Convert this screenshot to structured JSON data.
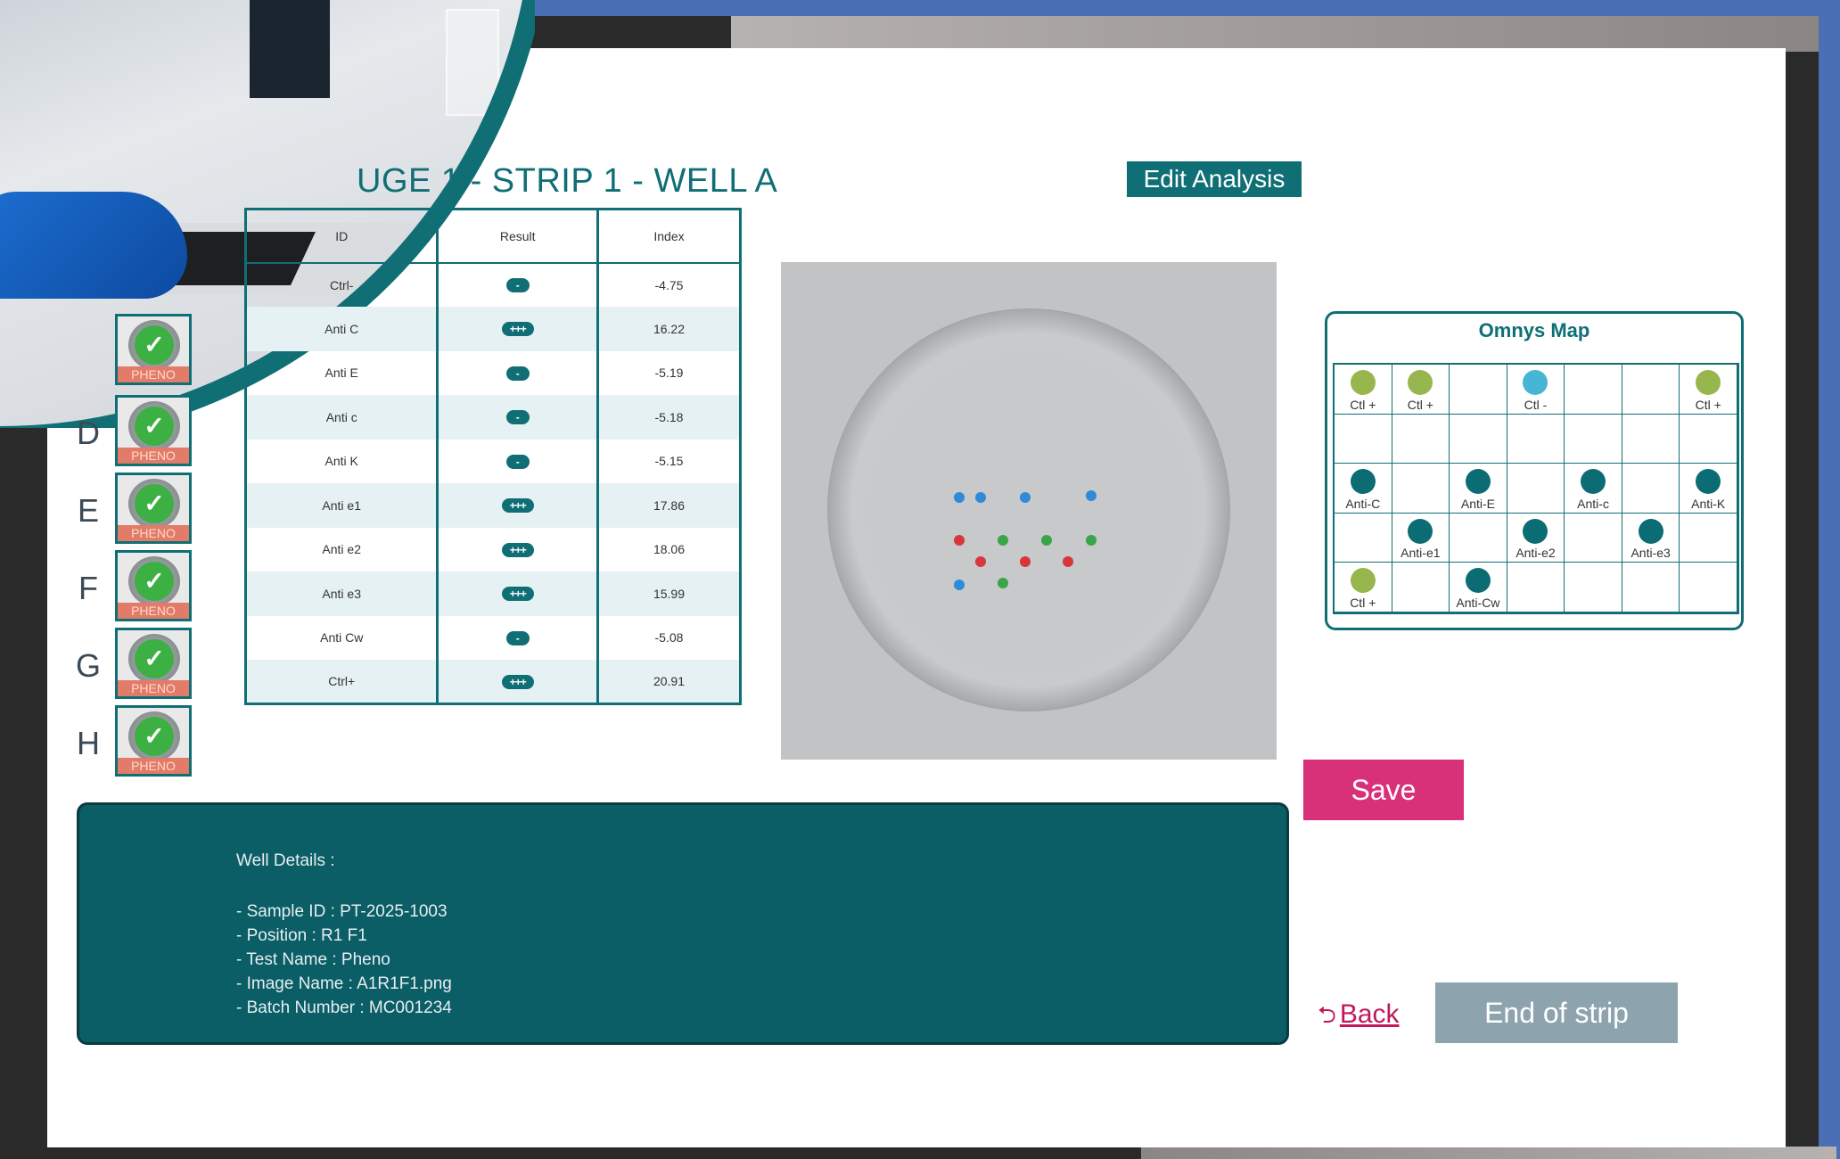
{
  "title": "UGE 1 - STRIP 1 - WELL A",
  "edit_analysis": "Edit Analysis",
  "wells": [
    {
      "letter": "",
      "tag": "PHENO"
    },
    {
      "letter": "D",
      "tag": "PHENO"
    },
    {
      "letter": "E",
      "tag": "PHENO"
    },
    {
      "letter": "F",
      "tag": "PHENO"
    },
    {
      "letter": "G",
      "tag": "PHENO"
    },
    {
      "letter": "H",
      "tag": "PHENO"
    }
  ],
  "table": {
    "headers": [
      "ID",
      "Result",
      "Index"
    ],
    "rows": [
      {
        "id": "Ctrl-",
        "result": "-",
        "index": "-4.75"
      },
      {
        "id": "Anti C",
        "result": "+++",
        "index": "16.22"
      },
      {
        "id": "Anti E",
        "result": "-",
        "index": "-5.19"
      },
      {
        "id": "Anti c",
        "result": "-",
        "index": "-5.18"
      },
      {
        "id": "Anti K",
        "result": "-",
        "index": "-5.15"
      },
      {
        "id": "Anti e1",
        "result": "+++",
        "index": "17.86"
      },
      {
        "id": "Anti e2",
        "result": "+++",
        "index": "18.06"
      },
      {
        "id": "Anti e3",
        "result": "+++",
        "index": "15.99"
      },
      {
        "id": "Anti Cw",
        "result": "-",
        "index": "-5.08"
      },
      {
        "id": "Ctrl+",
        "result": "+++",
        "index": "20.91"
      }
    ]
  },
  "omnys": {
    "title": "Omnys Map",
    "labels": {
      "r0c0": "Ctl +",
      "r0c1": "Ctl +",
      "r0c3": "Ctl -",
      "r0c6": "Ctl +",
      "r2c0": "Anti-C",
      "r2c2": "Anti-E",
      "r2c4": "Anti-c",
      "r2c6": "Anti-K",
      "r3c1": "Anti-e1",
      "r3c3": "Anti-e2",
      "r3c5": "Anti-e3",
      "r4c0": "Ctl +",
      "r4c2": "Anti-Cw"
    }
  },
  "save": "Save",
  "details": {
    "heading": "Well Details :",
    "lines": [
      "- Sample ID : PT-2025-1003",
      "- Position : R1 F1",
      "- Test Name : Pheno",
      "- Image Name : A1R1F1.png",
      "- Batch Number : MC001234"
    ]
  },
  "back": "Back",
  "end_of_strip": "End of strip",
  "colors": {
    "accent": "#0f6f75",
    "save": "#d9307a",
    "end": "#8da3ae",
    "panel": "#0b5e66"
  }
}
